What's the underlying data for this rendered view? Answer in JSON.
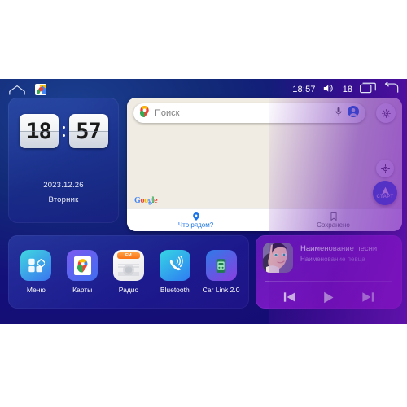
{
  "statusbar": {
    "home_icon": "home-outline-icon",
    "maps_icon": "google-maps-icon",
    "time": "18:57",
    "volume_icon": "volume-icon",
    "volume_level": "18",
    "recents_icon": "recent-apps-icon",
    "back_icon": "back-arrow-icon"
  },
  "clock_widget": {
    "hours": "18",
    "minutes": "57",
    "date": "2023.12.26",
    "weekday": "Вторник"
  },
  "maps_widget": {
    "search": {
      "placeholder": "Поиск",
      "pin_icon": "maps-pin-icon",
      "mic_icon": "microphone-icon",
      "avatar_icon": "account-avatar-icon",
      "gear_icon": "settings-gear-icon"
    },
    "locate_icon": "my-location-icon",
    "start_button_label": "СТАРТ",
    "watermark": "Google",
    "nav": [
      {
        "label": "Что рядом?",
        "icon": "location-pin-icon",
        "active": true
      },
      {
        "label": "Сохранено",
        "icon": "bookmark-icon",
        "active": false
      }
    ]
  },
  "apps": [
    {
      "label": "Меню",
      "icon": "apps-grid-icon"
    },
    {
      "label": "Карты",
      "icon": "google-maps-icon"
    },
    {
      "label": "Радио",
      "icon": "radio-icon",
      "badge": "FM"
    },
    {
      "label": "Bluetooth",
      "icon": "bluetooth-phone-icon"
    },
    {
      "label": "Car Link 2.0",
      "icon": "car-link-icon"
    }
  ],
  "music_widget": {
    "album_art_icon": "album-art-portrait",
    "title": "Наименование песни",
    "artist": "Наименование певца",
    "controls": [
      {
        "icon": "previous-track-icon"
      },
      {
        "icon": "play-icon"
      },
      {
        "icon": "next-track-icon"
      }
    ]
  },
  "colors": {
    "bg_blue": "#14107a",
    "bg_purple": "#7a17c4",
    "accent_blue": "#1a73e8",
    "map_bg": "#f0ece3",
    "card_text": "#ffffff"
  }
}
